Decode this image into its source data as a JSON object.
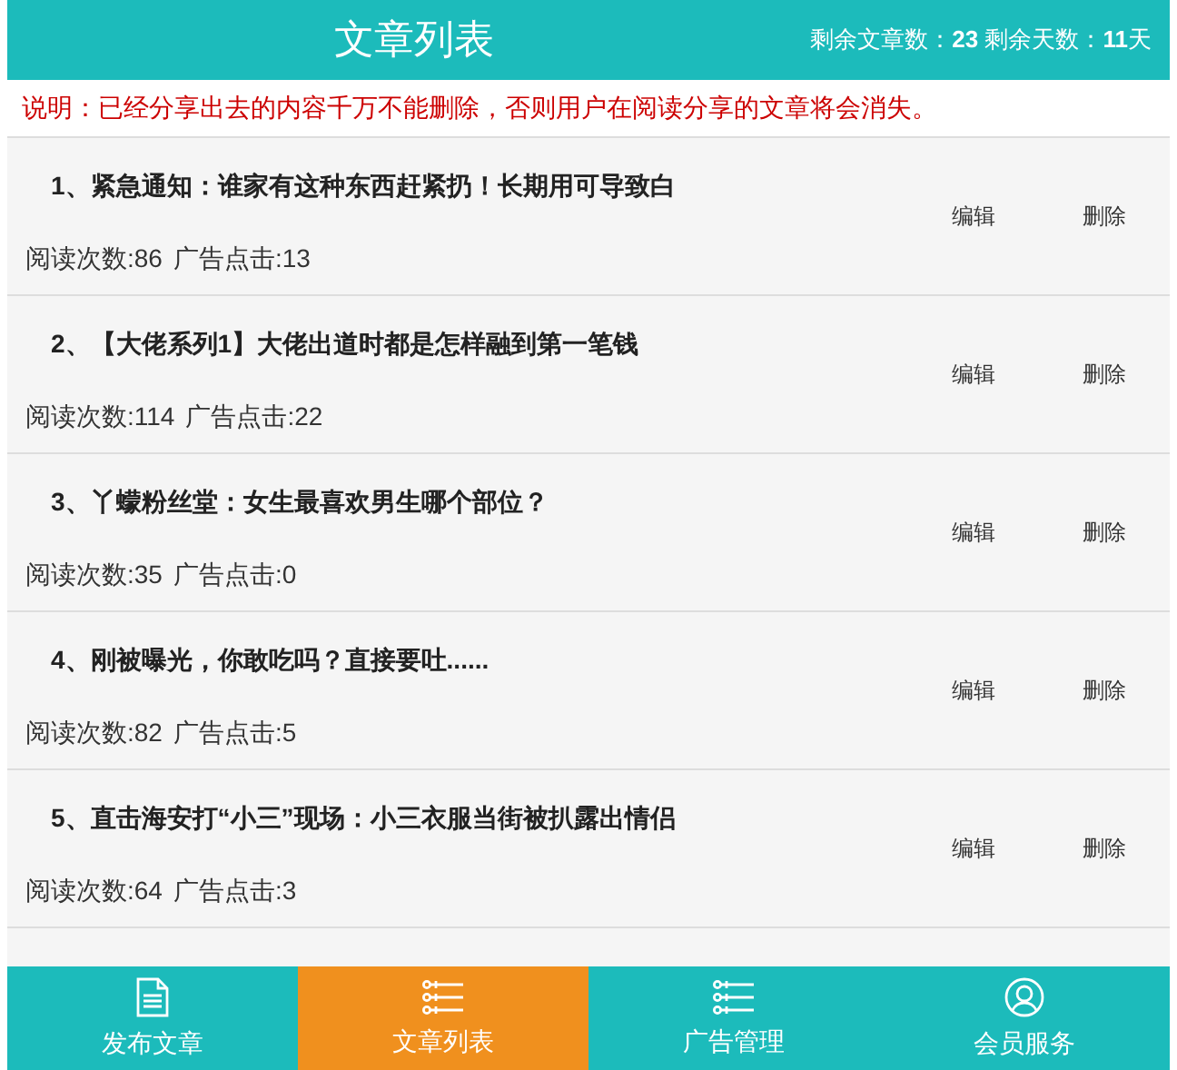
{
  "header": {
    "title": "文章列表",
    "stats": "剩余文章数：**23** 剩余天数：**11**天"
  },
  "notice": "说明：已经分享出去的内容千万不能删除，否则用户在阅读分享的文章将会消失。",
  "articles": [
    {
      "title": "1、紧急通知：谁家有这种东西赶紧扔！长期用可导致白",
      "reads": "阅读次数:86",
      "clicks": "广告点击:13",
      "edit": "编辑",
      "delete": "删除"
    },
    {
      "title": "2、【大佬系列1】大佬出道时都是怎样融到第一笔钱",
      "reads": "阅读次数:114",
      "clicks": "广告点击:22",
      "edit": "编辑",
      "delete": "删除"
    },
    {
      "title": "3、丫蠓粉丝堂：女生最喜欢男生哪个部位？",
      "reads": "阅读次数:35",
      "clicks": "广告点击:0",
      "edit": "编辑",
      "delete": "删除"
    },
    {
      "title": "4、刚被曝光，你敢吃吗？直接要吐......",
      "reads": "阅读次数:82",
      "clicks": "广告点击:5",
      "edit": "编辑",
      "delete": "删除"
    },
    {
      "title": "5、直击海安打“小三”现场：小三衣服当街被扒露出情侣",
      "reads": "阅读次数:64",
      "clicks": "广告点击:3",
      "edit": "编辑",
      "delete": "删除"
    }
  ],
  "tabs": [
    {
      "label": "发布文章",
      "kind": "publish",
      "selected": false
    },
    {
      "label": "文章列表",
      "kind": "articles",
      "selected": true
    },
    {
      "label": "广告管理",
      "kind": "ads",
      "selected": false
    },
    {
      "label": "会员服务",
      "kind": "member",
      "selected": false
    }
  ]
}
